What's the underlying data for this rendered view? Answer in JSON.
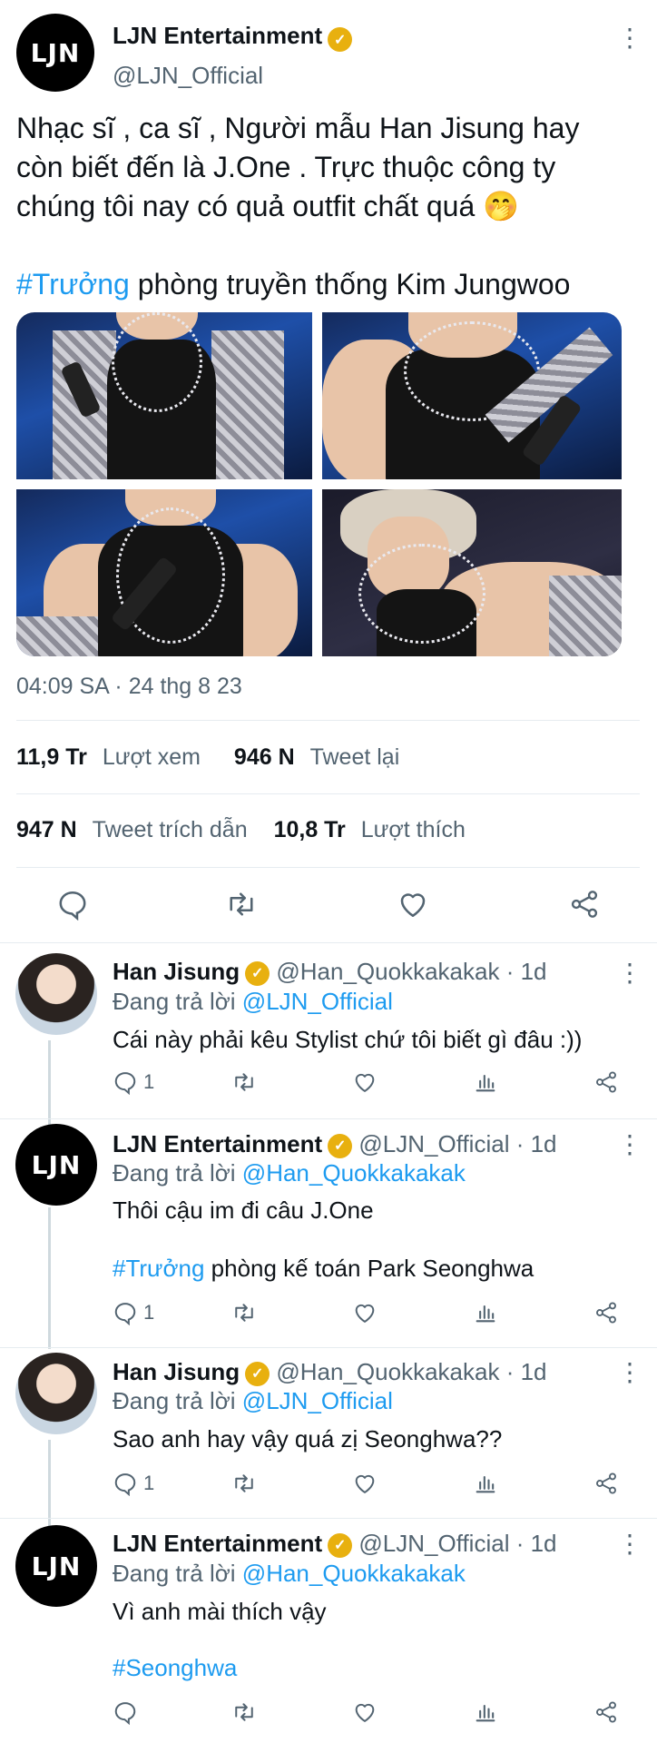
{
  "main_tweet": {
    "author_name": "LJN Entertainment",
    "author_handle": "@LJN_Official",
    "avatar_text": "LJN",
    "text_line1": "Nhạc sĩ , ca sĩ , Người mẫu Han Jisung hay",
    "text_line2": "còn biết đến là J.One . Trực thuộc công ty",
    "text_line3": "chúng tôi nay có quả outfit chất quá",
    "text_emoji": "🤭",
    "hashtag": "#Trưởng",
    "hashtag_rest": "phòng truyền thống Kim Jungwoo",
    "timestamp": "04:09 SA · 24 thg 8 23",
    "views_count": "11,9 Tr",
    "views_label": "Lượt xem",
    "retweets_count": "946 N",
    "retweets_label": "Tweet lại",
    "quotes_count": "947 N",
    "quotes_label": "Tweet trích dẫn",
    "likes_count": "10,8 Tr",
    "likes_label": "Lượt thích"
  },
  "replies": [
    {
      "author_name": "Han Jisung",
      "author_handle": "@Han_Quokkakakak",
      "time": "· 1d",
      "replying_prefix": "Đang trả lời",
      "replying_to": "@LJN_Official",
      "text": "Cái này phải kêu Stylist chứ tôi biết gì đâu :))",
      "reply_count": "1"
    },
    {
      "author_name": "LJN Entertainment",
      "author_handle": "@LJN_Official",
      "avatar_text": "LJN",
      "time": "· 1d",
      "replying_prefix": "Đang trả lời",
      "replying_to": "@Han_Quokkakakak",
      "text": "Thôi cậu im đi câu J.One",
      "hashtag": "#Trưởng",
      "hashtag_rest": "phòng kế toán Park Seonghwa",
      "reply_count": "1"
    },
    {
      "author_name": "Han Jisung",
      "author_handle": "@Han_Quokkakakak",
      "time": "· 1d",
      "replying_prefix": "Đang trả lời",
      "replying_to": "@LJN_Official",
      "text": "Sao anh hay vậy quá zị Seonghwa??",
      "reply_count": "1"
    },
    {
      "author_name": "LJN Entertainment",
      "author_handle": "@LJN_Official",
      "avatar_text": "LJN",
      "time": "· 1d",
      "replying_prefix": "Đang trả lời",
      "replying_to": "@Han_Quokkakakak",
      "text": "Vì anh mài thích vậy",
      "hashtag": "#Seonghwa"
    }
  ],
  "icons": {
    "verified": "✓",
    "more": "⋮",
    "reply": "reply-icon",
    "retweet": "retweet-icon",
    "like": "heart-icon",
    "share": "share-icon",
    "analytics": "analytics-icon"
  },
  "colors": {
    "link": "#1d9bf0",
    "verified": "#e8b00f",
    "muted": "#536471"
  }
}
